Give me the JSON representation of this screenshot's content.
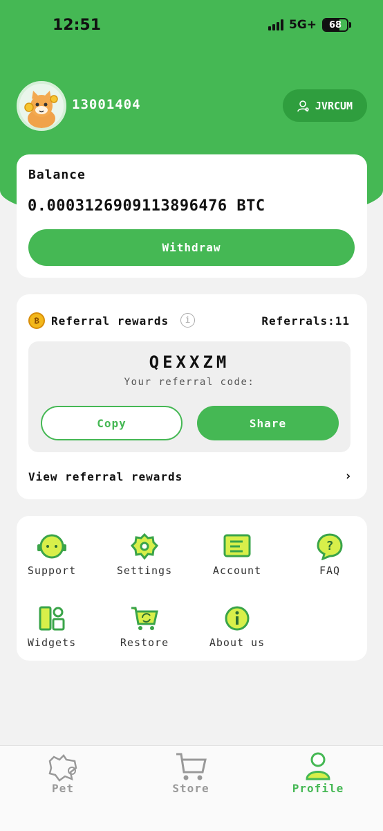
{
  "status_bar": {
    "time": "12:51",
    "network": "5G+",
    "battery": "68",
    "battery_level": 0.68
  },
  "user": {
    "id": "13001404",
    "badge_label": "JVRCUM"
  },
  "balance": {
    "label": "Balance",
    "value": "0.00031269091138964​76 BTC",
    "withdraw_label": "Withdraw"
  },
  "referral": {
    "title": "Referral rewards",
    "count_label": "Referrals:11",
    "code": "QEXXZM",
    "code_label": "Your referral code:",
    "copy_label": "Copy",
    "share_label": "Share",
    "view_label": "View referral rewards"
  },
  "menu": {
    "items": [
      {
        "label": "Support",
        "icon": "support-icon"
      },
      {
        "label": "Settings",
        "icon": "settings-icon"
      },
      {
        "label": "Account",
        "icon": "account-icon"
      },
      {
        "label": "FAQ",
        "icon": "faq-icon"
      },
      {
        "label": "Widgets",
        "icon": "widgets-icon"
      },
      {
        "label": "Restore",
        "icon": "restore-icon"
      },
      {
        "label": "About us",
        "icon": "about-icon"
      }
    ]
  },
  "tabs": [
    {
      "label": "Pet",
      "icon": "pet-icon",
      "active": false
    },
    {
      "label": "Store",
      "icon": "cart-icon",
      "active": false
    },
    {
      "label": "Profile",
      "icon": "profile-icon",
      "active": true
    }
  ],
  "colors": {
    "accent": "#45b854",
    "accent_dark": "#2f9e3e",
    "background": "#f2f2f2",
    "card": "#ffffff"
  }
}
